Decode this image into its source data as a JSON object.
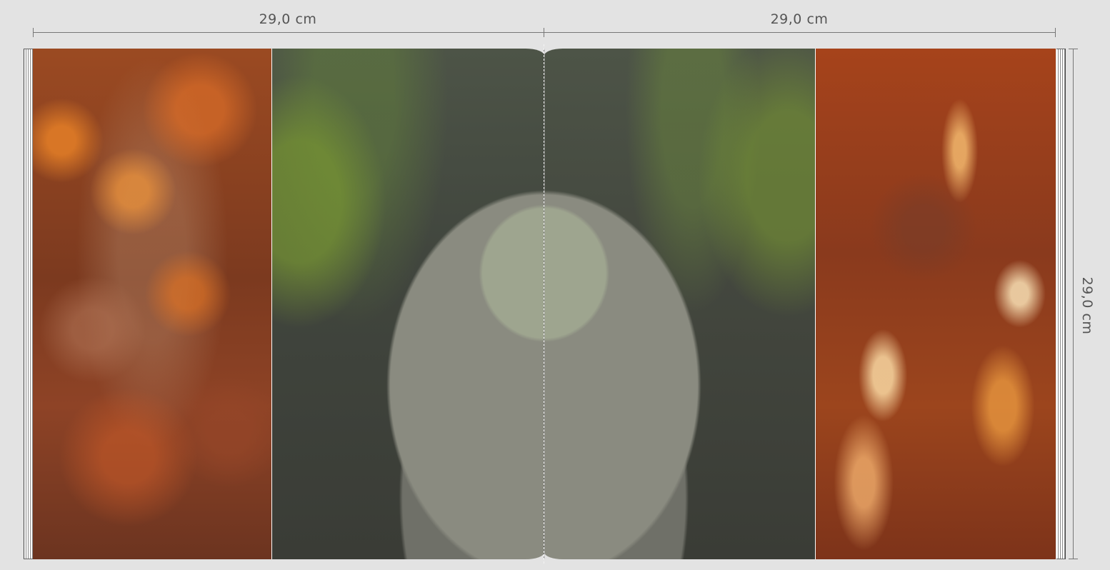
{
  "dimensions": {
    "left_width": "29,0 cm",
    "right_width": "29,0 cm",
    "height": "29,0 cm"
  },
  "colors": {
    "background": "#e3e3e3",
    "ruler": "#777777",
    "label": "#555555"
  },
  "panels": [
    {
      "name": "back-cover",
      "content": "rust-texture-photo"
    },
    {
      "name": "left-inner-page",
      "content": "stone-bollard-photo-left-half"
    },
    {
      "name": "right-inner-page",
      "content": "stone-bollard-photo-right-half"
    },
    {
      "name": "front-cover",
      "content": "rust-texture-photo"
    }
  ]
}
